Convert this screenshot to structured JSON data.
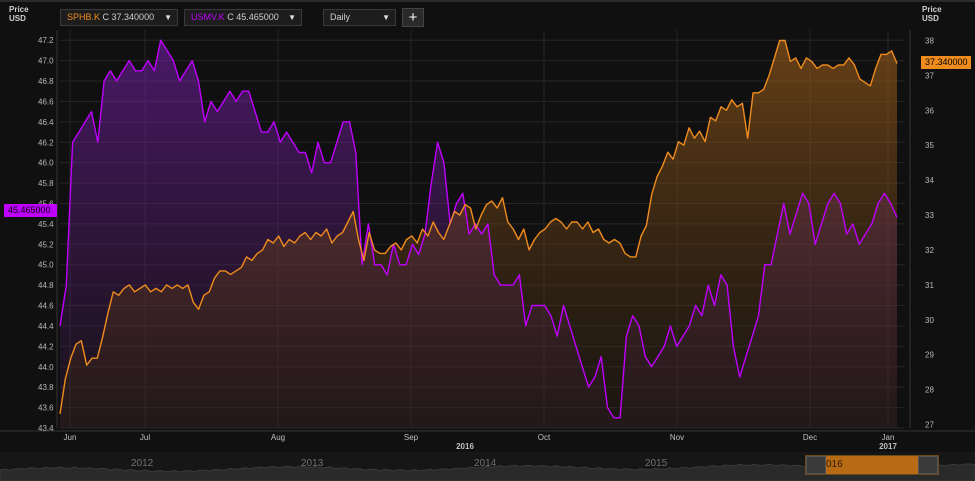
{
  "left_axis": {
    "title_line1": "Price",
    "title_line2": "USD"
  },
  "right_axis": {
    "title_line1": "Price",
    "title_line2": "USD"
  },
  "toolbar": {
    "series1_symbol": "SPHB.K",
    "series1_value": "C 37.340000",
    "series2_symbol": "USMV.K",
    "series2_value": "C 45.465000",
    "interval": "Daily",
    "add_label": "+"
  },
  "price_tags": {
    "left": "45.465000",
    "right": "37.340000"
  },
  "timeline": {
    "years": [
      "2012",
      "2013",
      "2014",
      "2015",
      "016"
    ],
    "window_label": "016"
  },
  "colors": {
    "sphb": "#f08c1e",
    "usmv": "#c000ff",
    "background": "#101010",
    "grid": "#2a2a2a"
  },
  "chart_data": {
    "type": "line",
    "title": "",
    "x_month_labels": [
      "Jun",
      "Jul",
      "Aug",
      "Sep",
      "Oct",
      "Nov",
      "Dec",
      "Jan"
    ],
    "x_year_labels": [
      "2016",
      "2017"
    ],
    "y_left": {
      "ticks": [
        "43.4",
        "43.6",
        "43.8",
        "44.0",
        "44.2",
        "44.4",
        "44.6",
        "44.8",
        "45.0",
        "45.2",
        "45.4",
        "45.6",
        "45.8",
        "46.0",
        "46.2",
        "46.4",
        "46.6",
        "46.8",
        "47.0",
        "47.2"
      ],
      "range": [
        43.4,
        47.3
      ]
    },
    "y_right": {
      "ticks": [
        "27",
        "28",
        "29",
        "30",
        "31",
        "32",
        "33",
        "34",
        "35",
        "36",
        "37",
        "38"
      ],
      "range": [
        26.9,
        38.3
      ]
    },
    "series": [
      {
        "name": "SPHB.K",
        "axis": "right",
        "color": "#f08c1e",
        "values": [
          27.3,
          28.3,
          28.9,
          29.3,
          29.4,
          28.7,
          28.9,
          28.9,
          29.5,
          30.2,
          30.8,
          30.7,
          30.9,
          31.0,
          30.8,
          30.9,
          31.0,
          30.8,
          30.9,
          30.8,
          31.0,
          30.9,
          31.0,
          30.9,
          31.0,
          30.5,
          30.3,
          30.7,
          30.8,
          31.2,
          31.4,
          31.4,
          31.3,
          31.4,
          31.5,
          31.8,
          31.7,
          31.9,
          32.0,
          32.3,
          32.2,
          32.4,
          32.1,
          32.3,
          32.2,
          32.4,
          32.5,
          32.3,
          32.5,
          32.4,
          32.6,
          32.2,
          32.4,
          32.5,
          32.8,
          33.1,
          32.3,
          31.7,
          32.5,
          32.0,
          31.9,
          31.9,
          32.1,
          32.2,
          32.0,
          32.3,
          32.4,
          32.2,
          32.6,
          32.4,
          32.8,
          32.5,
          32.3,
          32.7,
          33.1,
          33.0,
          33.3,
          33.2,
          32.6,
          33.0,
          33.3,
          33.4,
          33.2,
          33.5,
          32.8,
          32.6,
          32.3,
          32.6,
          32.0,
          32.3,
          32.5,
          32.6,
          32.8,
          32.9,
          32.8,
          32.6,
          32.8,
          32.8,
          32.6,
          32.8,
          32.5,
          32.6,
          32.3,
          32.2,
          32.3,
          32.2,
          31.9,
          31.8,
          31.8,
          32.4,
          32.7,
          33.6,
          34.1,
          34.4,
          34.8,
          34.6,
          35.1,
          35.0,
          35.5,
          35.2,
          35.4,
          35.1,
          35.8,
          35.7,
          36.1,
          36.0,
          36.3,
          36.1,
          36.2,
          35.2,
          36.5,
          36.5,
          36.6,
          37.0,
          37.5,
          38.0,
          38.0,
          37.4,
          37.5,
          37.2,
          37.5,
          37.4,
          37.2,
          37.3,
          37.3,
          37.2,
          37.3,
          37.3,
          37.5,
          37.3,
          36.9,
          36.8,
          36.7,
          37.2,
          37.6,
          37.6,
          37.7,
          37.34
        ]
      },
      {
        "name": "USMV.K",
        "axis": "left",
        "color": "#c000ff",
        "values": [
          44.4,
          44.8,
          46.2,
          46.3,
          46.4,
          46.5,
          46.2,
          46.8,
          46.9,
          46.8,
          46.9,
          47.0,
          46.9,
          46.9,
          47.0,
          46.9,
          47.2,
          47.1,
          47.0,
          46.8,
          46.9,
          47.0,
          46.8,
          46.4,
          46.6,
          46.5,
          46.6,
          46.7,
          46.6,
          46.7,
          46.7,
          46.5,
          46.3,
          46.3,
          46.4,
          46.2,
          46.3,
          46.2,
          46.1,
          46.1,
          45.9,
          46.2,
          46.0,
          46.0,
          46.2,
          46.4,
          46.4,
          46.1,
          45.0,
          45.4,
          45.0,
          45.0,
          44.9,
          45.2,
          45.0,
          45.0,
          45.2,
          45.1,
          45.3,
          45.8,
          46.2,
          46.0,
          45.4,
          45.6,
          45.7,
          45.3,
          45.4,
          45.3,
          45.4,
          44.9,
          44.8,
          44.8,
          44.8,
          44.9,
          44.4,
          44.6,
          44.6,
          44.6,
          44.5,
          44.3,
          44.6,
          44.4,
          44.2,
          44.0,
          43.8,
          43.9,
          44.1,
          43.6,
          43.5,
          43.5,
          44.3,
          44.5,
          44.4,
          44.1,
          44.0,
          44.1,
          44.2,
          44.4,
          44.2,
          44.3,
          44.4,
          44.6,
          44.5,
          44.8,
          44.6,
          44.9,
          44.8,
          44.2,
          43.9,
          44.1,
          44.3,
          44.5,
          45.0,
          45.0,
          45.3,
          45.6,
          45.3,
          45.5,
          45.7,
          45.6,
          45.2,
          45.4,
          45.6,
          45.7,
          45.6,
          45.3,
          45.4,
          45.2,
          45.3,
          45.4,
          45.6,
          45.7,
          45.6,
          45.465
        ]
      }
    ]
  }
}
